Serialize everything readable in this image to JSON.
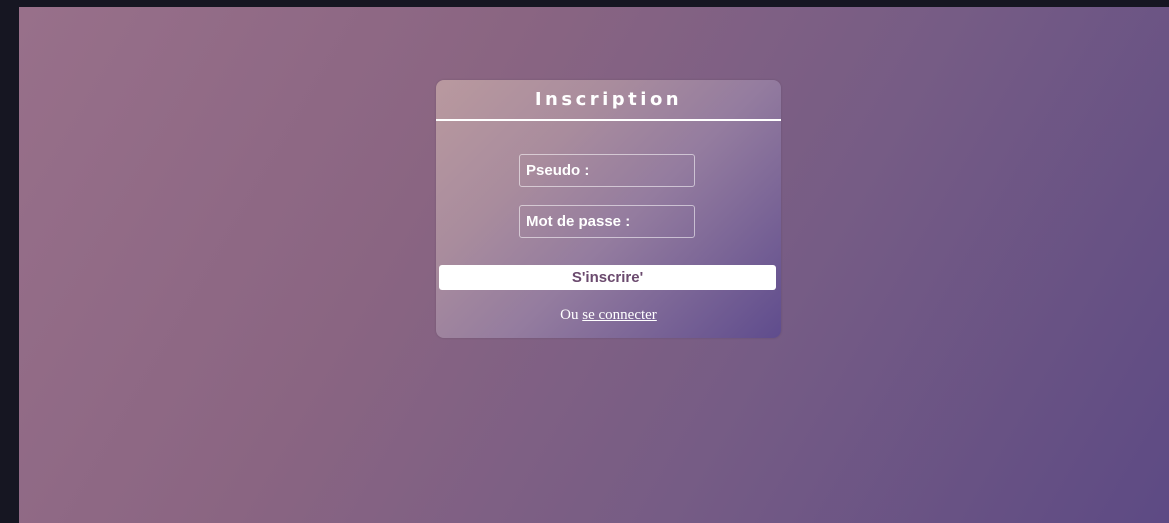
{
  "form": {
    "title": "Inscription",
    "pseudo_placeholder": "Pseudo :",
    "password_placeholder": "Mot de passe :",
    "submit_label": "S'inscrire'",
    "footer_prefix": "Ou",
    "login_link": "se connecter"
  },
  "colors": {
    "background_start": "#98708a",
    "background_end": "#5d4a84",
    "text": "#ffffff",
    "button_text": "#6b4a6e"
  }
}
